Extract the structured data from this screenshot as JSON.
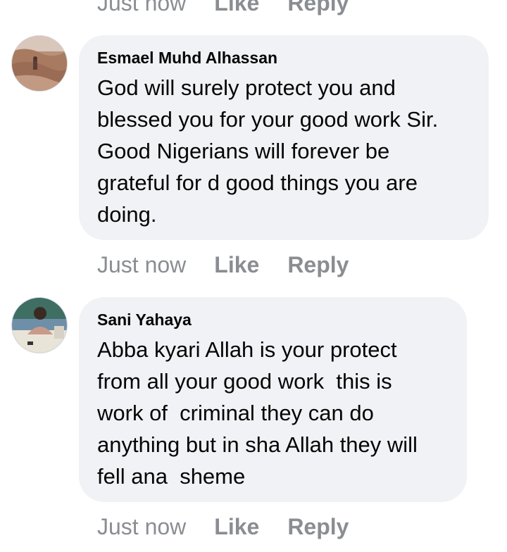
{
  "comments": [
    {
      "author": "",
      "text": "",
      "time": "Just now",
      "like": "Like",
      "reply": "Reply"
    },
    {
      "author": "Esmael Muhd Alhassan",
      "text": "God will surely protect you and\nblessed you for your good work Sir.\nGood Nigerians will forever be\ngrateful for d good things you are\ndoing.",
      "time": "Just now",
      "like": "Like",
      "reply": "Reply"
    },
    {
      "author": "Sani Yahaya",
      "text": "Abba kyari Allah is your protect\nfrom all your good work  this is\nwork of  criminal they can do\nanything but in sha Allah they will\nfell ana  sheme",
      "time": "Just now",
      "like": "Like",
      "reply": "Reply"
    }
  ],
  "icons": {
    "avatar_1": "user-photo-desert",
    "avatar_2": "user-photo-office"
  }
}
